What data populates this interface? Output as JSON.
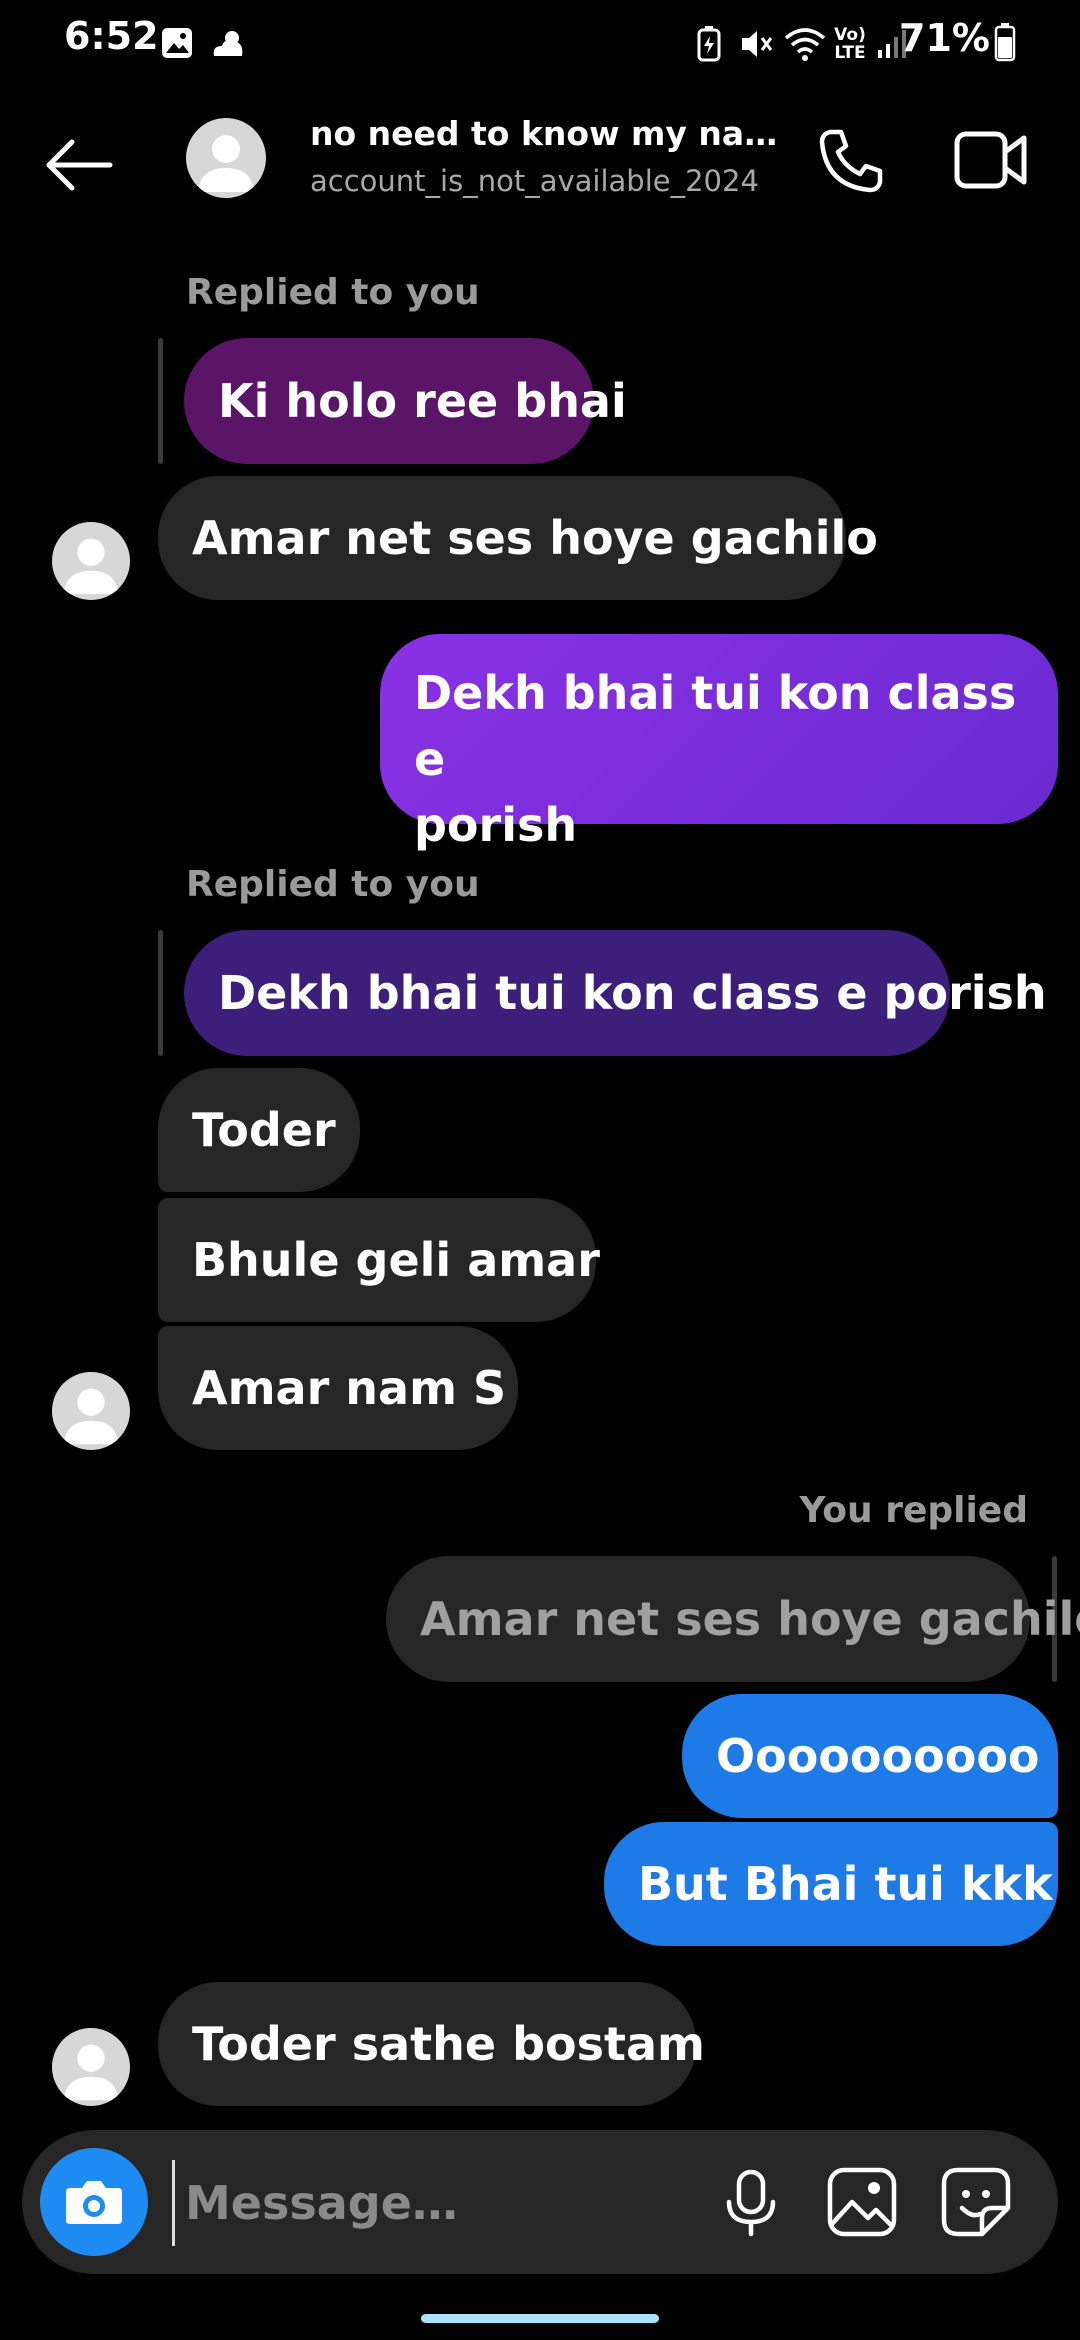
{
  "status_bar": {
    "time": "6:52",
    "battery": "71%",
    "network_label": "Vo) LTE"
  },
  "header": {
    "name": "no need to know my na…",
    "username": "account_is_not_available_2024"
  },
  "messages": {
    "m1_reply_label": "Replied to you",
    "m1_quote": "Ki holo ree bhai",
    "m2": "Amar net ses hoye gachilo",
    "m3_line1": "Dekh bhai tui kon class e",
    "m3_line2": "porish",
    "m4_reply_label": "Replied to you",
    "m4_quote": "Dekh bhai tui kon class e porish",
    "m5": "Toder",
    "m6": "Bhule geli amar",
    "m7": "Amar nam S",
    "m8_reply_label": "You replied",
    "m8_quote": "Amar net ses hoye gachilo",
    "m9": "Oooooooooo",
    "m10": "But Bhai tui kkk",
    "m11": "Toder sathe bostam"
  },
  "composer": {
    "placeholder": "Message…"
  },
  "colors": {
    "incoming_bubble": "#262626",
    "outgoing_purple_start": "#8a31e6",
    "outgoing_purple_end": "#6a2ad0",
    "outgoing_blue": "#1e7ae6",
    "quote_purple_1": "#5a1468",
    "quote_purple_2": "#3b1f7a",
    "camera_blue": "#1d8bf1"
  }
}
